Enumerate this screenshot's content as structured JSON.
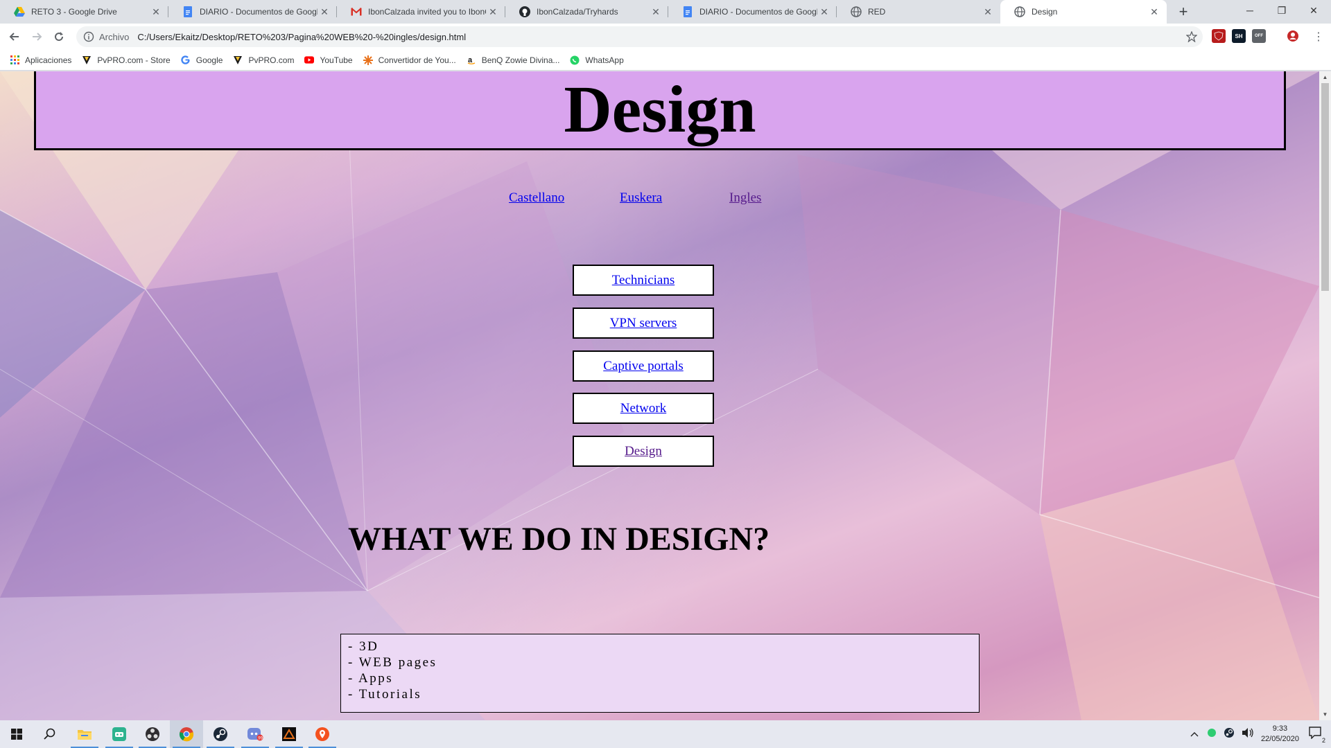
{
  "browser": {
    "tabs": [
      {
        "title": "RETO 3 - Google Drive",
        "icon": "google-drive-icon",
        "active": false
      },
      {
        "title": "DIARIO - Documentos de Google",
        "icon": "google-docs-icon",
        "active": false
      },
      {
        "title": "IbonCalzada invited you to IbonC",
        "icon": "gmail-icon",
        "active": false
      },
      {
        "title": "IbonCalzada/Tryhards",
        "icon": "github-icon",
        "active": false
      },
      {
        "title": "DIARIO - Documentos de Google",
        "icon": "google-docs-icon",
        "active": false
      },
      {
        "title": "RED",
        "icon": "globe-icon",
        "active": false
      },
      {
        "title": "Design",
        "icon": "globe-icon",
        "active": true
      }
    ],
    "new_tab": "+",
    "window_controls": {
      "minimize": "─",
      "maximize": "❐",
      "close": "✕"
    },
    "scheme_label": "Archivo",
    "url": "C:/Users/Ekaitz/Desktop/RETO%203/Pagina%20WEB%20-%20ingles/design.html",
    "bookmarks": [
      {
        "label": "Aplicaciones",
        "icon": "apps-grid-icon"
      },
      {
        "label": "PvPRO.com - Store",
        "icon": "pvpro-icon"
      },
      {
        "label": "Google",
        "icon": "google-icon"
      },
      {
        "label": "PvPRO.com",
        "icon": "pvpro-icon"
      },
      {
        "label": "YouTube",
        "icon": "youtube-icon"
      },
      {
        "label": "Convertidor de You...",
        "icon": "converter-icon"
      },
      {
        "label": "BenQ Zowie Divina...",
        "icon": "amazon-icon"
      },
      {
        "label": "WhatsApp",
        "icon": "whatsapp-icon"
      }
    ],
    "extensions": {
      "ext_sh": "SH",
      "ext_off": "OFF"
    }
  },
  "page": {
    "header_title": "Design",
    "languages": [
      "Castellano",
      "Euskera",
      "Ingles"
    ],
    "nav": [
      "Technicians",
      "VPN servers",
      "Captive portals",
      "Network",
      "Design"
    ],
    "section_title": "WHAT WE DO IN DESIGN?",
    "list_items": [
      "- 3D",
      "- WEB pages",
      "- Apps",
      "- Tutorials"
    ]
  },
  "taskbar": {
    "apps": [
      "windows-start-icon",
      "search-icon",
      "file-explorer-icon",
      "gaming-app-icon",
      "obs-icon",
      "chrome-icon",
      "steam-icon",
      "discord-icon",
      "terminal-app-icon",
      "maps-app-icon"
    ],
    "time": "9:33",
    "date": "22/05/2020",
    "notification_count": "2"
  },
  "colors": {
    "header_bg": "#d9a4ee",
    "link": "#0000ee",
    "visited_link": "#551a8b",
    "list_bg": "#ecd9f5"
  }
}
